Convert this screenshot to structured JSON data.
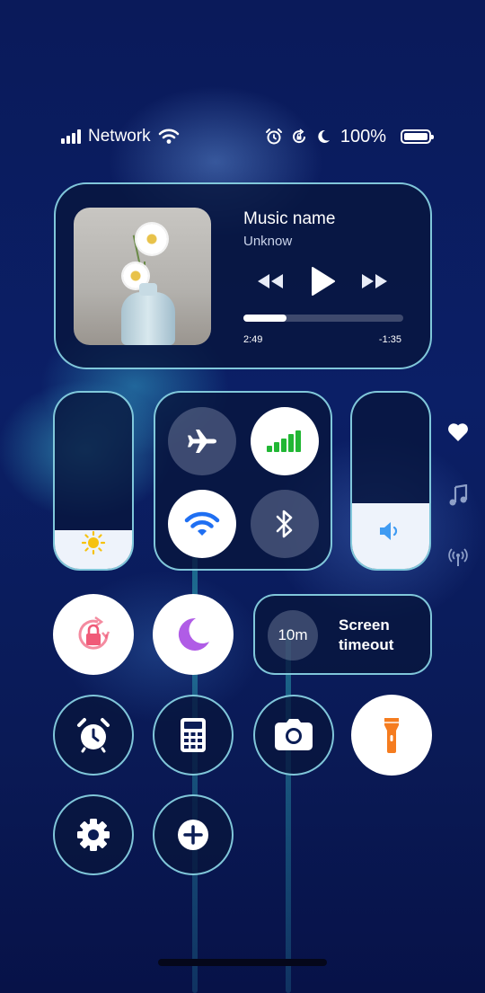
{
  "status_bar": {
    "network_label": "Network",
    "battery_percent": "100%",
    "icons": [
      "signal-icon",
      "wifi-icon",
      "alarm-icon",
      "rotation-lock-icon",
      "moon-icon",
      "battery-icon"
    ]
  },
  "music": {
    "title": "Music name",
    "artist": "Unknow",
    "elapsed": "2:49",
    "remaining": "-1:35",
    "progress_fraction": 0.27
  },
  "sliders": {
    "brightness_level": 0.22,
    "volume_level": 0.37
  },
  "connectivity": {
    "airplane": "off",
    "mobile_data": "on",
    "wifi": "on",
    "bluetooth": "off"
  },
  "toggles": {
    "rotation_lock": "on",
    "do_not_disturb": "on",
    "flashlight": "on"
  },
  "screen_timeout": {
    "value": "10m",
    "label": "Screen timeout"
  },
  "colors": {
    "accent_blue": "#1f6ff2",
    "signal_green": "#22b735",
    "rotation_pink": "#f05a78",
    "moon_purple": "#b05ce6",
    "flashlight_orange": "#f57c1f",
    "panel_border": "#96e6f5"
  },
  "side_icons": [
    "heart-icon",
    "music-note-icon",
    "broadcast-icon"
  ],
  "shortcuts": [
    "alarm-clock-icon",
    "calculator-icon",
    "camera-icon",
    "flashlight-icon",
    "settings-gear-icon",
    "add-icon"
  ]
}
